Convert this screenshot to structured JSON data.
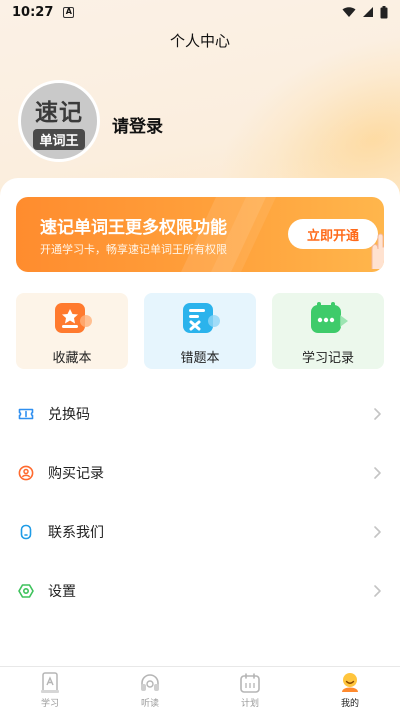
{
  "status_bar": {
    "time": "10:27",
    "notification_icon": "a-letter-icon",
    "wifi_icon": "wifi-icon",
    "signal_icon": "signal-icon",
    "battery_icon": "battery-icon"
  },
  "header": {
    "title": "个人中心"
  },
  "profile": {
    "avatar_line1": "速记",
    "avatar_line2": "单词王",
    "login_prompt": "请登录"
  },
  "banner": {
    "title": "速记单词王更多权限功能",
    "subtitle": "开通学习卡，畅享速记单词王所有权限",
    "button_label": "立即开通"
  },
  "cards": [
    {
      "label": "收藏本",
      "icon": "star-box-icon",
      "bg": "#fdf4e8",
      "color": "#ff7a2e"
    },
    {
      "label": "错题本",
      "icon": "x-note-icon",
      "bg": "#e6f5fd",
      "color": "#2bb3ec"
    },
    {
      "label": "学习记录",
      "icon": "chat-note-icon",
      "bg": "#ecf8ec",
      "color": "#3ecb6a"
    }
  ],
  "menu": [
    {
      "label": "兑换码",
      "icon": "ticket-icon",
      "color": "#2f8ff0"
    },
    {
      "label": "购买记录",
      "icon": "receipt-icon",
      "color": "#ff6a2e"
    },
    {
      "label": "联系我们",
      "icon": "phone-icon",
      "color": "#1f9ce6"
    },
    {
      "label": "设置",
      "icon": "hexagon-gear-icon",
      "color": "#3ec25c"
    }
  ],
  "tabs": [
    {
      "label": "学习",
      "icon": "book-icon",
      "active": false
    },
    {
      "label": "听读",
      "icon": "headphones-icon",
      "active": false
    },
    {
      "label": "计划",
      "icon": "calendar-icon",
      "active": false
    },
    {
      "label": "我的",
      "icon": "smiley-profile-icon",
      "active": true
    }
  ],
  "colors": {
    "accent": "#ff8c2e",
    "header_bg": "#fbf1e6"
  }
}
